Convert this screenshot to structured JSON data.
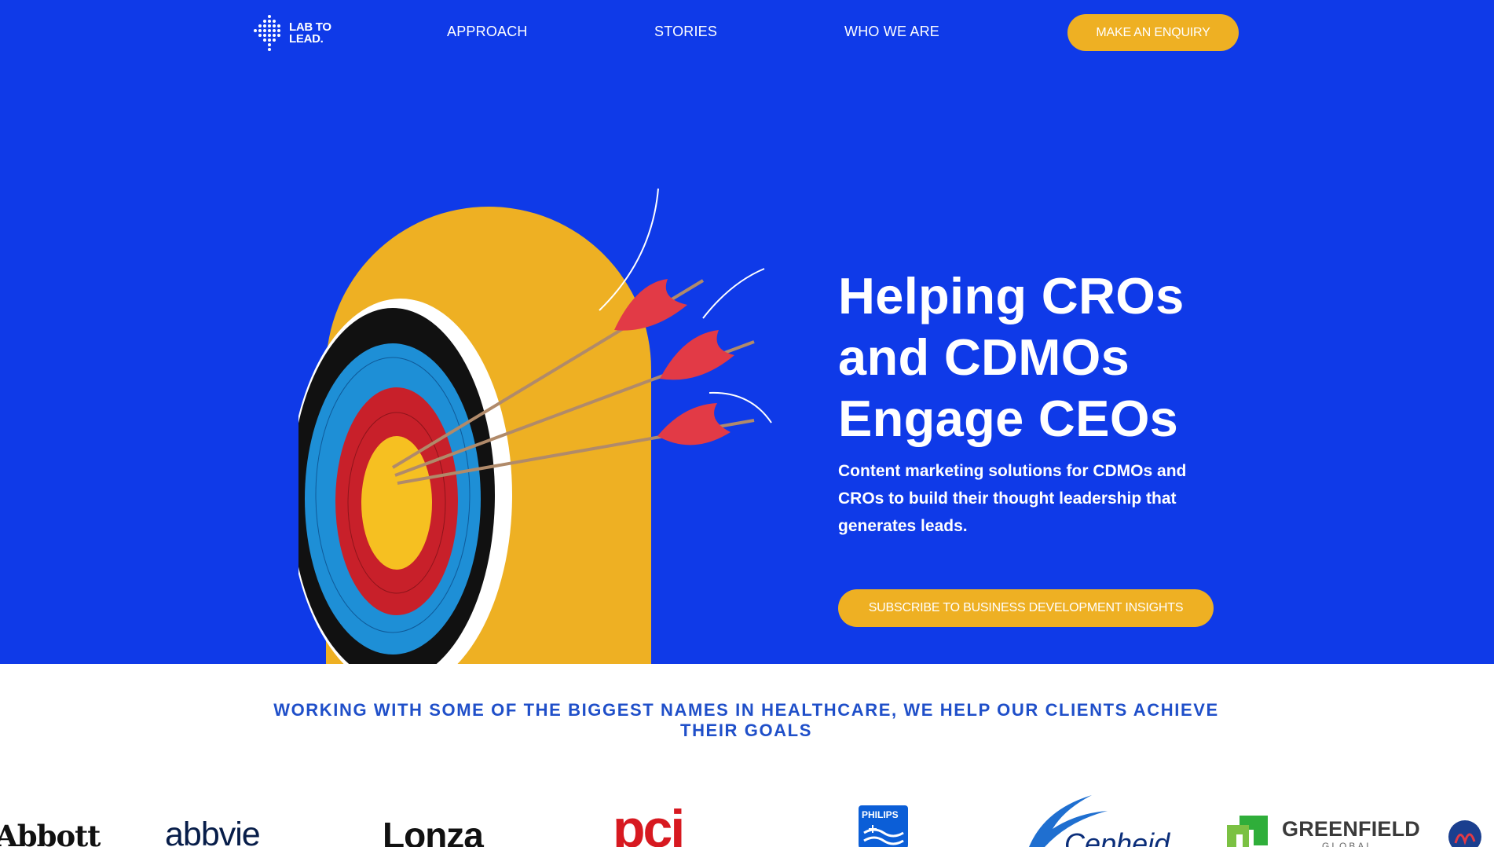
{
  "nav": {
    "logo_line1": "LAB TO",
    "logo_line2": "LEAD.",
    "items": [
      "APPROACH",
      "STORIES",
      "WHO WE ARE"
    ],
    "cta": "MAKE AN ENQUIRY"
  },
  "hero": {
    "title_lines": [
      "Helping CROs",
      "and CDMOs",
      "Engage CEOs"
    ],
    "subtitle": "Content marketing solutions for CDMOs and CROs to build their thought leadership that generates leads.",
    "cta": "SUBSCRIBE TO BUSINESS DEVELOPMENT INSIGHTS"
  },
  "clients": {
    "heading": "WORKING WITH SOME OF THE BIGGEST NAMES IN HEALTHCARE, WE HELP OUR CLIENTS ACHIEVE THEIR GOALS",
    "logos": {
      "abbott": "Abbott",
      "abbvie": "abbvie",
      "lonza": "Lonza",
      "pci": "pci",
      "philips": "PHILIPS",
      "cepheid": "Cepheid",
      "greenfield": "GREENFIELD",
      "greenfield_sub": "GLOBAL"
    }
  },
  "colors": {
    "hero_bg": "#0f3ae8",
    "accent_yellow": "#eeb023",
    "heading_blue": "#1f4fc9",
    "target_red": "#c8202a",
    "target_blue": "#1e8fd6"
  },
  "icons": [
    "dotted-logo-icon",
    "target-illustration",
    "arrow-icon"
  ]
}
